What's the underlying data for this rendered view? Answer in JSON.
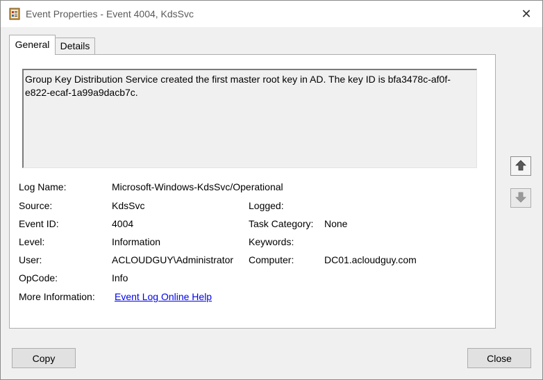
{
  "window": {
    "title": "Event Properties - Event 4004, KdsSvc",
    "close_glyph": "✕"
  },
  "tabs": [
    {
      "label": "General",
      "active": true
    },
    {
      "label": "Details",
      "active": false
    }
  ],
  "message": "Group Key Distribution Service created the first master root key in AD.  The key ID is bfa3478c-af0f-e822-ecaf-1a99a9dacb7c.",
  "fields": {
    "log_name": {
      "label": "Log Name:",
      "value": "Microsoft-Windows-KdsSvc/Operational"
    },
    "source": {
      "label": "Source:",
      "value": "KdsSvc"
    },
    "logged": {
      "label": "Logged:",
      "value": ""
    },
    "event_id": {
      "label": "Event ID:",
      "value": "4004"
    },
    "task_category": {
      "label": "Task Category:",
      "value": "None"
    },
    "level": {
      "label": "Level:",
      "value": "Information"
    },
    "keywords": {
      "label": "Keywords:",
      "value": ""
    },
    "user": {
      "label": "User:",
      "value": "ACLOUDGUY\\Administrator"
    },
    "computer": {
      "label": "Computer:",
      "value": "DC01.acloudguy.com"
    },
    "opcode": {
      "label": "OpCode:",
      "value": "Info"
    },
    "more_info": {
      "label": "More Information:",
      "link": "Event Log Online Help"
    }
  },
  "buttons": {
    "copy": "Copy",
    "close": "Close"
  },
  "icons": {
    "app": "event-viewer-icon",
    "up": "arrow-up-icon",
    "down": "arrow-down-icon"
  }
}
